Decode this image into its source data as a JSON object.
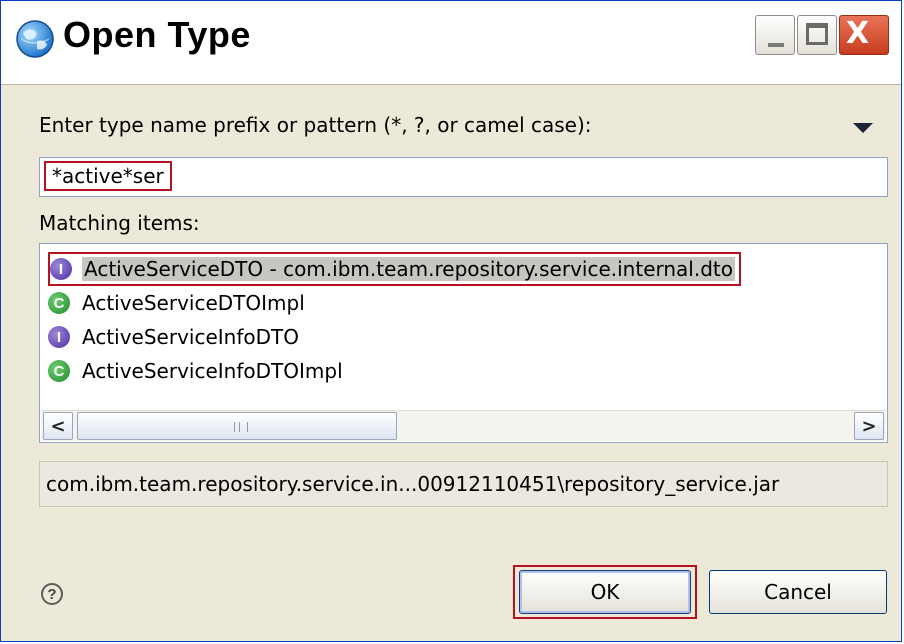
{
  "window": {
    "title": "Open Type",
    "icon": "eclipse-globe-icon",
    "controls": [
      "minimize-icon",
      "maximize-icon",
      "close-icon"
    ],
    "close_glyph": "X"
  },
  "search": {
    "prompt": "Enter type name prefix or pattern (*, ?, or camel case):",
    "value": "*active*ser"
  },
  "matching": {
    "label": "Matching items:",
    "items": [
      {
        "kind": "interface",
        "icon_letter": "I",
        "text": "ActiveServiceDTO - com.ibm.team.repository.service.internal.dto",
        "selected": true
      },
      {
        "kind": "class",
        "icon_letter": "C",
        "text": "ActiveServiceDTOImpl",
        "selected": false
      },
      {
        "kind": "interface",
        "icon_letter": "I",
        "text": "ActiveServiceInfoDTO",
        "selected": false
      },
      {
        "kind": "class",
        "icon_letter": "C",
        "text": "ActiveServiceInfoDTOImpl",
        "selected": false
      }
    ]
  },
  "scrollbar": {
    "left_arrow": "<",
    "right_arrow": ">"
  },
  "status": {
    "text": "com.ibm.team.repository.service.in...00912110451\\repository_service.jar"
  },
  "footer": {
    "help_glyph": "?",
    "ok_label": "OK",
    "cancel_label": "Cancel"
  },
  "colors": {
    "highlight_border": "#b3131f",
    "selection_bg": "#c7c6c1",
    "interface_icon": "#4b2fa3",
    "class_icon": "#1f8b2c",
    "close_button": "#c73d1e"
  }
}
